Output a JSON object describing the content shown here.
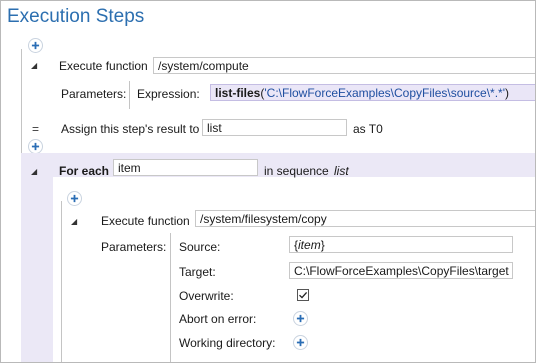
{
  "page": {
    "title": "Execution Steps"
  },
  "step1": {
    "collapse_glyph": "◢",
    "label": "Execute function",
    "function_path": "/system/compute",
    "parameters_label": "Parameters:",
    "expression_label": "Expression:",
    "expression_fn": "list-files",
    "expression_open": "(",
    "expression_arg": "'C:\\FlowForceExamples\\CopyFiles\\source\\*.*'",
    "expression_close": ")",
    "assign_glyph": "=",
    "assign_label": "Assign this step's result to",
    "assign_value": "list",
    "as_label": "as T0"
  },
  "foreach": {
    "collapse_glyph": "◢",
    "label": "For each",
    "item_value": "item",
    "in_sequence_label": "in sequence",
    "sequence_value": "list"
  },
  "step2": {
    "collapse_glyph": "◢",
    "label": "Execute function",
    "function_path": "/system/filesystem/copy",
    "parameters_label": "Parameters:",
    "params": {
      "source_label": "Source:",
      "source_open": "{",
      "source_value": "item",
      "source_close": "}",
      "target_label": "Target:",
      "target_value": "C:\\FlowForceExamples\\CopyFiles\\target",
      "overwrite_label": "Overwrite:",
      "overwrite_checked": true,
      "abort_label": "Abort on error:",
      "working_dir_label": "Working directory:"
    }
  },
  "icons": {
    "add": "plus-circle-icon",
    "collapse": "triangle-collapse-icon",
    "check": "checkmark-icon"
  },
  "colors": {
    "title": "#2c6fb0",
    "plus": "#2a6db5",
    "band": "#ebe8f6",
    "input_highlight": "#eae6f7",
    "string_literal": "#1f4fa0"
  }
}
